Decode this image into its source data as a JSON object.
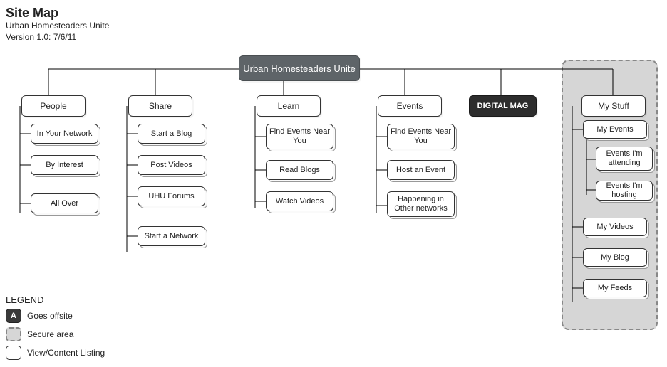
{
  "header": {
    "title": "Site Map",
    "subtitle": "Urban Homesteaders Unite",
    "version": "Version 1.0: 7/6/11"
  },
  "root": "Urban Homesteaders Unite",
  "columns": {
    "people": {
      "label": "People",
      "children": [
        "In Your Network",
        "By Interest",
        "All Over"
      ]
    },
    "share": {
      "label": "Share",
      "children": [
        "Start a Blog",
        "Post Videos",
        "UHU Forums",
        "Start a Network"
      ]
    },
    "learn": {
      "label": "Learn",
      "children": [
        "Find Events Near You",
        "Read Blogs",
        "Watch Videos"
      ]
    },
    "events": {
      "label": "Events",
      "children": [
        "Find Events Near You",
        "Host an Event",
        "Happening in Other networks"
      ]
    },
    "digital": {
      "label": "DIGITAL MAG"
    },
    "mystuff": {
      "label": "My Stuff",
      "children": [
        "My Events",
        "My Videos",
        "My Blog",
        "My Feeds"
      ],
      "sub_events": [
        "Events I'm attending",
        "Events I'm hosting"
      ]
    }
  },
  "legend": {
    "title": "LEGEND",
    "offsite_letter": "A",
    "offsite": "Goes offsite",
    "secure": "Secure area",
    "listing": "View/Content Listing"
  }
}
